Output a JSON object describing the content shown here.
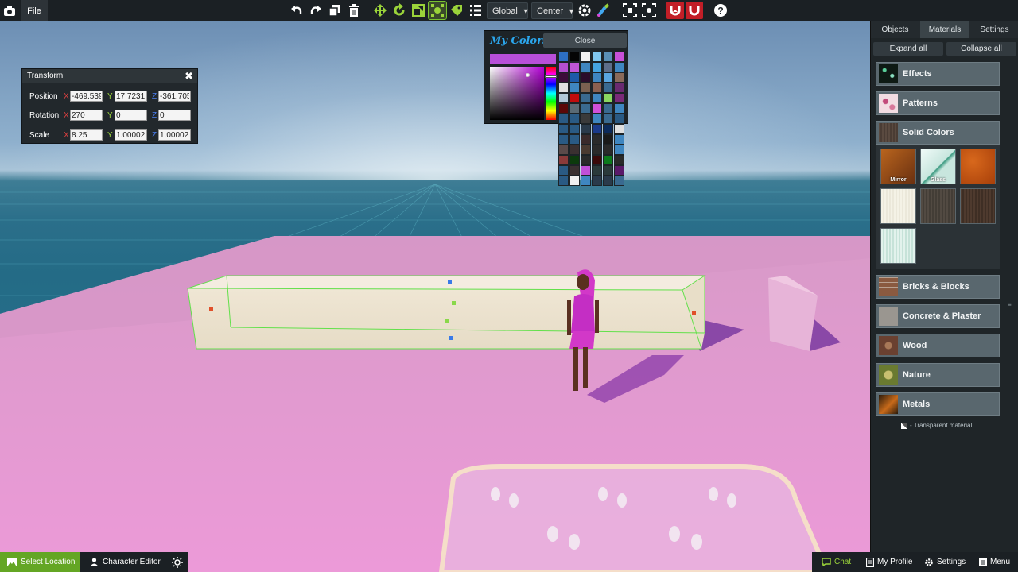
{
  "toolbar": {
    "file_label": "File",
    "space_dropdown": "Global",
    "pivot_dropdown": "Center",
    "accent_color": "#9ad33a",
    "magnet_color": "#c21e27"
  },
  "transform": {
    "title": "Transform",
    "position": {
      "label": "Position",
      "x": "-469.539",
      "y": "17.7231",
      "z": "-361.705"
    },
    "rotation": {
      "label": "Rotation",
      "x": "270",
      "y": "0",
      "z": "0"
    },
    "scale": {
      "label": "Scale",
      "x": "8.25",
      "y": "1.00002",
      "z": "1.00002"
    },
    "axis_x": "X",
    "axis_y": "Y",
    "axis_z": "Z"
  },
  "colors_panel": {
    "title": "My Colors",
    "close_label": "Close",
    "current_color": "#b84fd9",
    "swatches": [
      "#2d6fc4",
      "#050505",
      "#f2f2f2",
      "#7fc6ee",
      "#5a8fb5",
      "#c850d8",
      "#b44fd0",
      "#c056d8",
      "#3f86c0",
      "#45a4e0",
      "#5e6e8a",
      "#3f86c0",
      "#3c0c3a",
      "#1c5aa8",
      "#2a0d2a",
      "#3f86c0",
      "#5aa6e0",
      "#8a6a5a",
      "#e0e0e0",
      "#3f86c0",
      "#7a6050",
      "#8a6050",
      "#3a6a90",
      "#6a2a70",
      "#b0c8d8",
      "#c00c0c",
      "#3a6a90",
      "#3f86c0",
      "#8ad860",
      "#7a2a78",
      "#5a0808",
      "#5a6a74",
      "#3a6a90",
      "#d050d8",
      "#3a6a90",
      "#3f86c0",
      "#2a5a84",
      "#2a5a84",
      "#3a3a3a",
      "#3f86c0",
      "#3a6a90",
      "#2a5a84",
      "#2a5a84",
      "#2a5a84",
      "#2a3a4a",
      "#1a3a8a",
      "#0c2a5a",
      "#e0e0e0",
      "#2a5a84",
      "#2a5a84",
      "#3a2a2a",
      "#2a2a2a",
      "#1a1a1a",
      "#3f86c0",
      "#5a4a4a",
      "#3a3030",
      "#4a3a30",
      "#2a2a2a",
      "#2a2a2a",
      "#3f86c0",
      "#8a3a3a",
      "#0c3a0c",
      "#2a2a2a",
      "#3a0a0a",
      "#0c7a1c",
      "#2a2a2a",
      "#2a5a84",
      "#3a3030",
      "#c050d8",
      "#2a3a3a",
      "#2a3a3a",
      "#5a1a6a",
      "#2a5a84",
      "#f0f0f0",
      "#3f86c0",
      "#2a3a4a",
      "#2a3a4a",
      "#3a6a90"
    ]
  },
  "right_panel": {
    "tabs": [
      {
        "label": "Objects"
      },
      {
        "label": "Materials"
      },
      {
        "label": "Settings"
      }
    ],
    "active_tab": "Materials",
    "expand_label": "Expand all",
    "collapse_label": "Collapse all",
    "categories": [
      {
        "name": "Effects",
        "thumb": "#1a2a20"
      },
      {
        "name": "Patterns",
        "thumb": "#e8c4cc"
      },
      {
        "name": "Solid Colors",
        "thumb": "#5a4a40"
      },
      {
        "name": "Bricks & Blocks",
        "thumb": "#8a5a40"
      },
      {
        "name": "Concrete & Plaster",
        "thumb": "#8a8a84"
      },
      {
        "name": "Wood",
        "thumb": "#6a4030"
      },
      {
        "name": "Nature",
        "thumb": "#8a9a50"
      },
      {
        "name": "Metals",
        "thumb": "#6a3a1a"
      }
    ],
    "materials": [
      {
        "label": "Mirror",
        "color": "#8a4a1a"
      },
      {
        "label": "Glass",
        "color": "#cfe8e2"
      },
      {
        "label": "",
        "color": "#b84d0c"
      },
      {
        "label": "",
        "color": "#f0ede0"
      },
      {
        "label": "",
        "color": "#4e4840"
      },
      {
        "label": "",
        "color": "#4a382e"
      },
      {
        "label": "",
        "color": "#d6ece6"
      }
    ],
    "transparent_note": "- Transparent material"
  },
  "bottom_bar": {
    "select_location": "Select Location",
    "character_editor": "Character Editor",
    "chat": "Chat",
    "my_profile": "My Profile",
    "settings": "Settings",
    "menu": "Menu"
  }
}
